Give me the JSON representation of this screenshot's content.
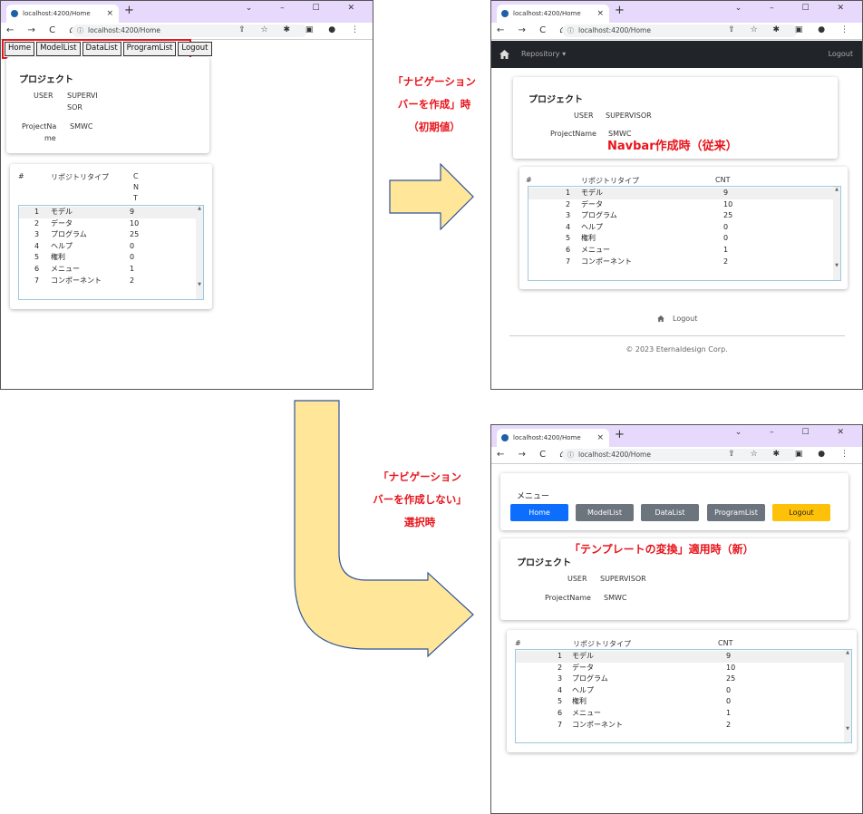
{
  "browser": {
    "tab_title": "localhost:4200/Home",
    "url": "localhost:4200/Home",
    "new_tab": "+",
    "close": "×",
    "window_controls": "⌄ – ☐ ✕",
    "nav_icons": "← → C ⌂",
    "right_icons": "⇪ ☆ ✱ ▣ ● ⋮",
    "info_icon": "ⓘ"
  },
  "left": {
    "menu": [
      "Home",
      "ModelList",
      "DataList",
      "ProgramList",
      "Logout"
    ],
    "title": "プロジェクト",
    "user_label": "USER",
    "user_value_1": "SUPERVI",
    "user_value_2": "SOR",
    "proj_label_1": "ProjectNa",
    "proj_label_2": "me",
    "proj_value": "SMWC",
    "col_hash": "#",
    "col_type": "リポジトリタイプ",
    "col_cnt_1": "C",
    "col_cnt_2": "N",
    "col_cnt_3": "T"
  },
  "top_right": {
    "brand_icon": "home-icon",
    "repository": "Repository ▾",
    "logout": "Logout",
    "title": "プロジェクト",
    "user_label": "USER",
    "user_value": "SUPERVISOR",
    "proj_label": "ProjectName",
    "proj_value": "SMWC",
    "col_hash": "#",
    "col_type": "リポジトリタイプ",
    "col_cnt": "CNT",
    "footer_logout": "Logout",
    "copyright": "© 2023 Eternaldesign Corp."
  },
  "bottom_right": {
    "menu_title": "メニュー",
    "buttons": [
      {
        "label": "Home",
        "color": "#0d6efd"
      },
      {
        "label": "ModelList",
        "color": "#6c757d"
      },
      {
        "label": "DataList",
        "color": "#6c757d"
      },
      {
        "label": "ProgramList",
        "color": "#6c757d"
      },
      {
        "label": "Logout",
        "color": "#ffc107"
      }
    ],
    "title": "プロジェクト",
    "user_label": "USER",
    "user_value": "SUPERVISOR",
    "proj_label": "ProjectName",
    "proj_value": "SMWC",
    "col_hash": "#",
    "col_type": "リポジトリタイプ",
    "col_cnt": "CNT"
  },
  "rows": [
    {
      "n": "1",
      "type": "モデル",
      "cnt": "9"
    },
    {
      "n": "2",
      "type": "データ",
      "cnt": "10"
    },
    {
      "n": "3",
      "type": "プログラム",
      "cnt": "25"
    },
    {
      "n": "4",
      "type": "ヘルプ",
      "cnt": "0"
    },
    {
      "n": "5",
      "type": "権利",
      "cnt": "0"
    },
    {
      "n": "6",
      "type": "メニュー",
      "cnt": "1"
    },
    {
      "n": "7",
      "type": "コンポーネント",
      "cnt": "2"
    }
  ],
  "annotations": {
    "a1_line1": "「ナビゲーション",
    "a1_line2": "バーを作成」時",
    "a1_line3": "（初期値）",
    "a2": "Navbar作成時（従来）",
    "a3_line1": "「ナビゲーション",
    "a3_line2": "バーを作成しない」",
    "a3_line3": "選択時",
    "a4": "「テンプレートの変換」適用時（新）"
  },
  "colors": {
    "accent_red": "#e8141b",
    "arrow_fill": "#ffe699",
    "arrow_stroke": "#2f5597",
    "navbar": "#212529"
  }
}
